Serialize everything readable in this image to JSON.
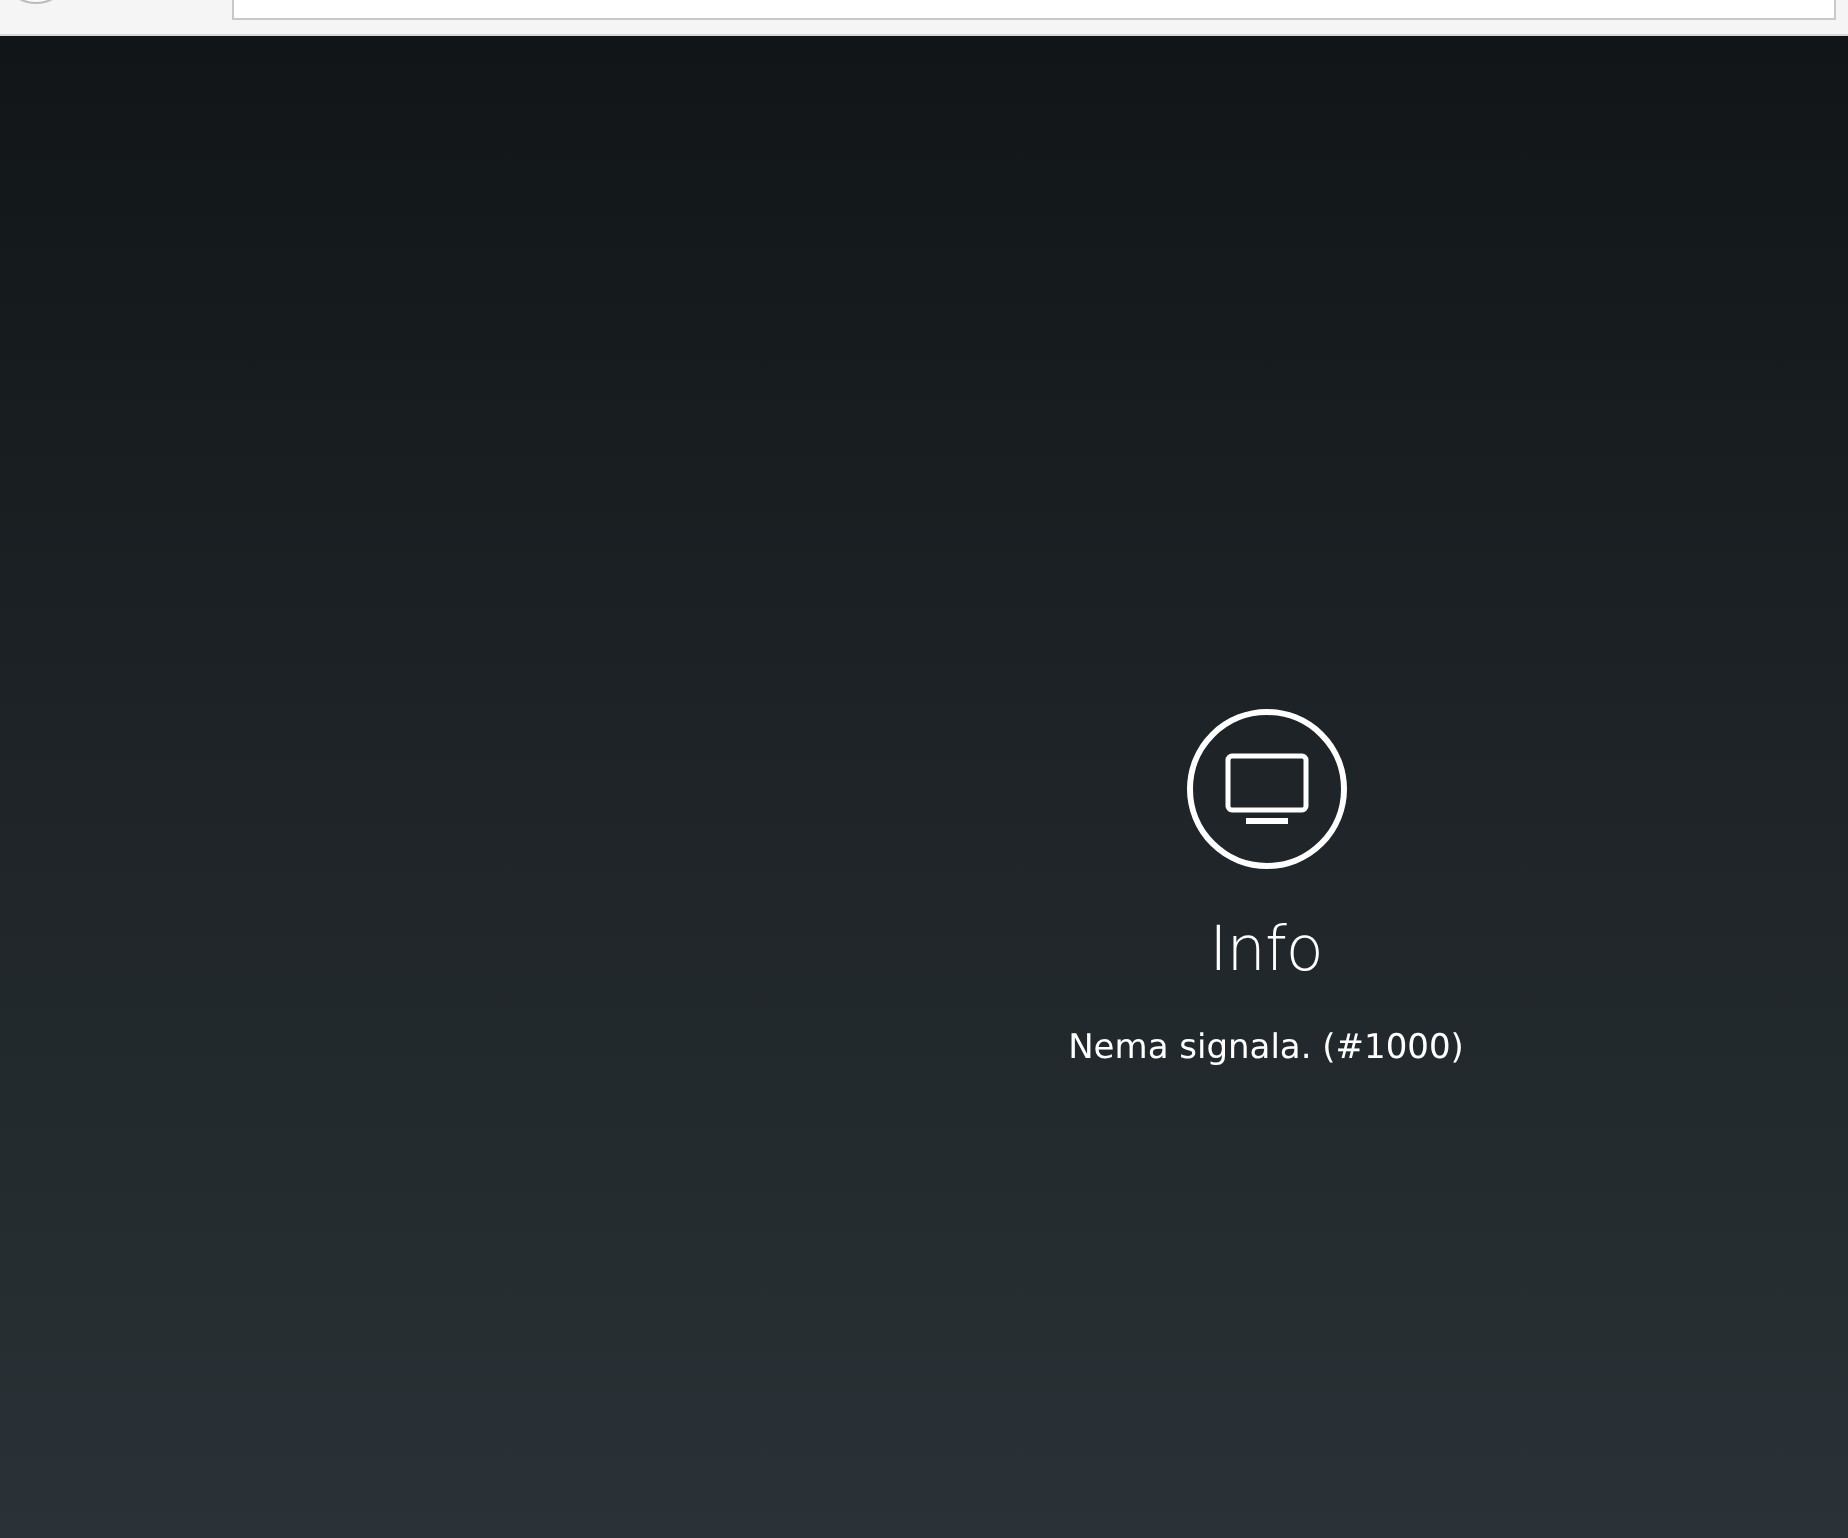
{
  "player_message": {
    "title": "Info",
    "message": "Nema signala. (#1000)"
  }
}
